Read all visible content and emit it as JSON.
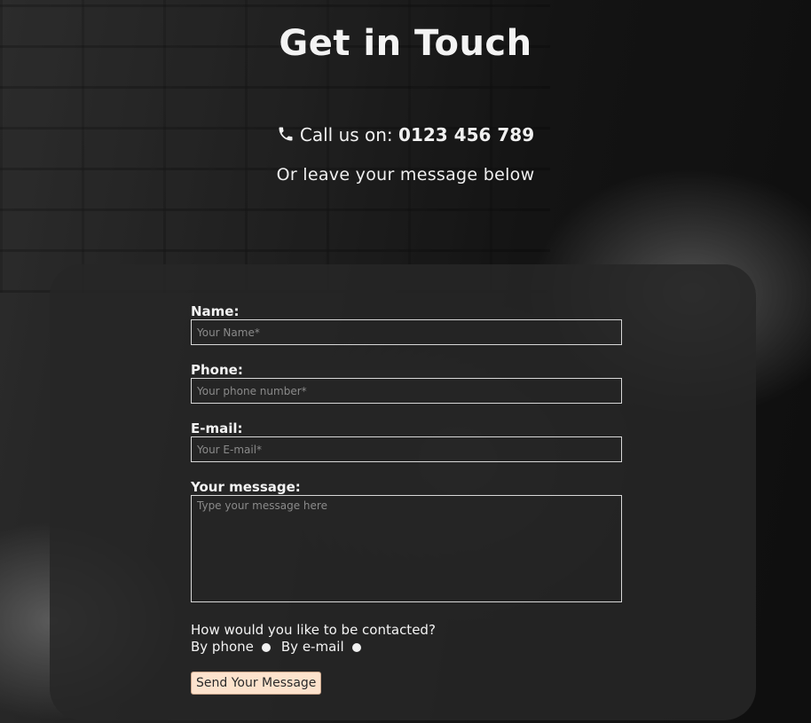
{
  "header": {
    "title": "Get in Touch",
    "call_prefix": "Call us on:",
    "phone_number": "0123 456 789",
    "subtitle": "Or leave your message below",
    "phone_icon": "phone-icon"
  },
  "form": {
    "name": {
      "label": "Name:",
      "placeholder": "Your Name*"
    },
    "phone": {
      "label": "Phone:",
      "placeholder": "Your phone number*"
    },
    "email": {
      "label": "E-mail:",
      "placeholder": "Your E-mail*"
    },
    "message": {
      "label": "Your message:",
      "placeholder": "Type your message here"
    },
    "contact_question": "How would you like to be contacted?",
    "contact_options": [
      {
        "label": "By phone"
      },
      {
        "label": "By e-mail"
      }
    ],
    "submit_label": "Send Your Message"
  },
  "colors": {
    "button_bg": "#fde3cd",
    "card_bg": "#262626",
    "text": "#f3f3f3"
  }
}
